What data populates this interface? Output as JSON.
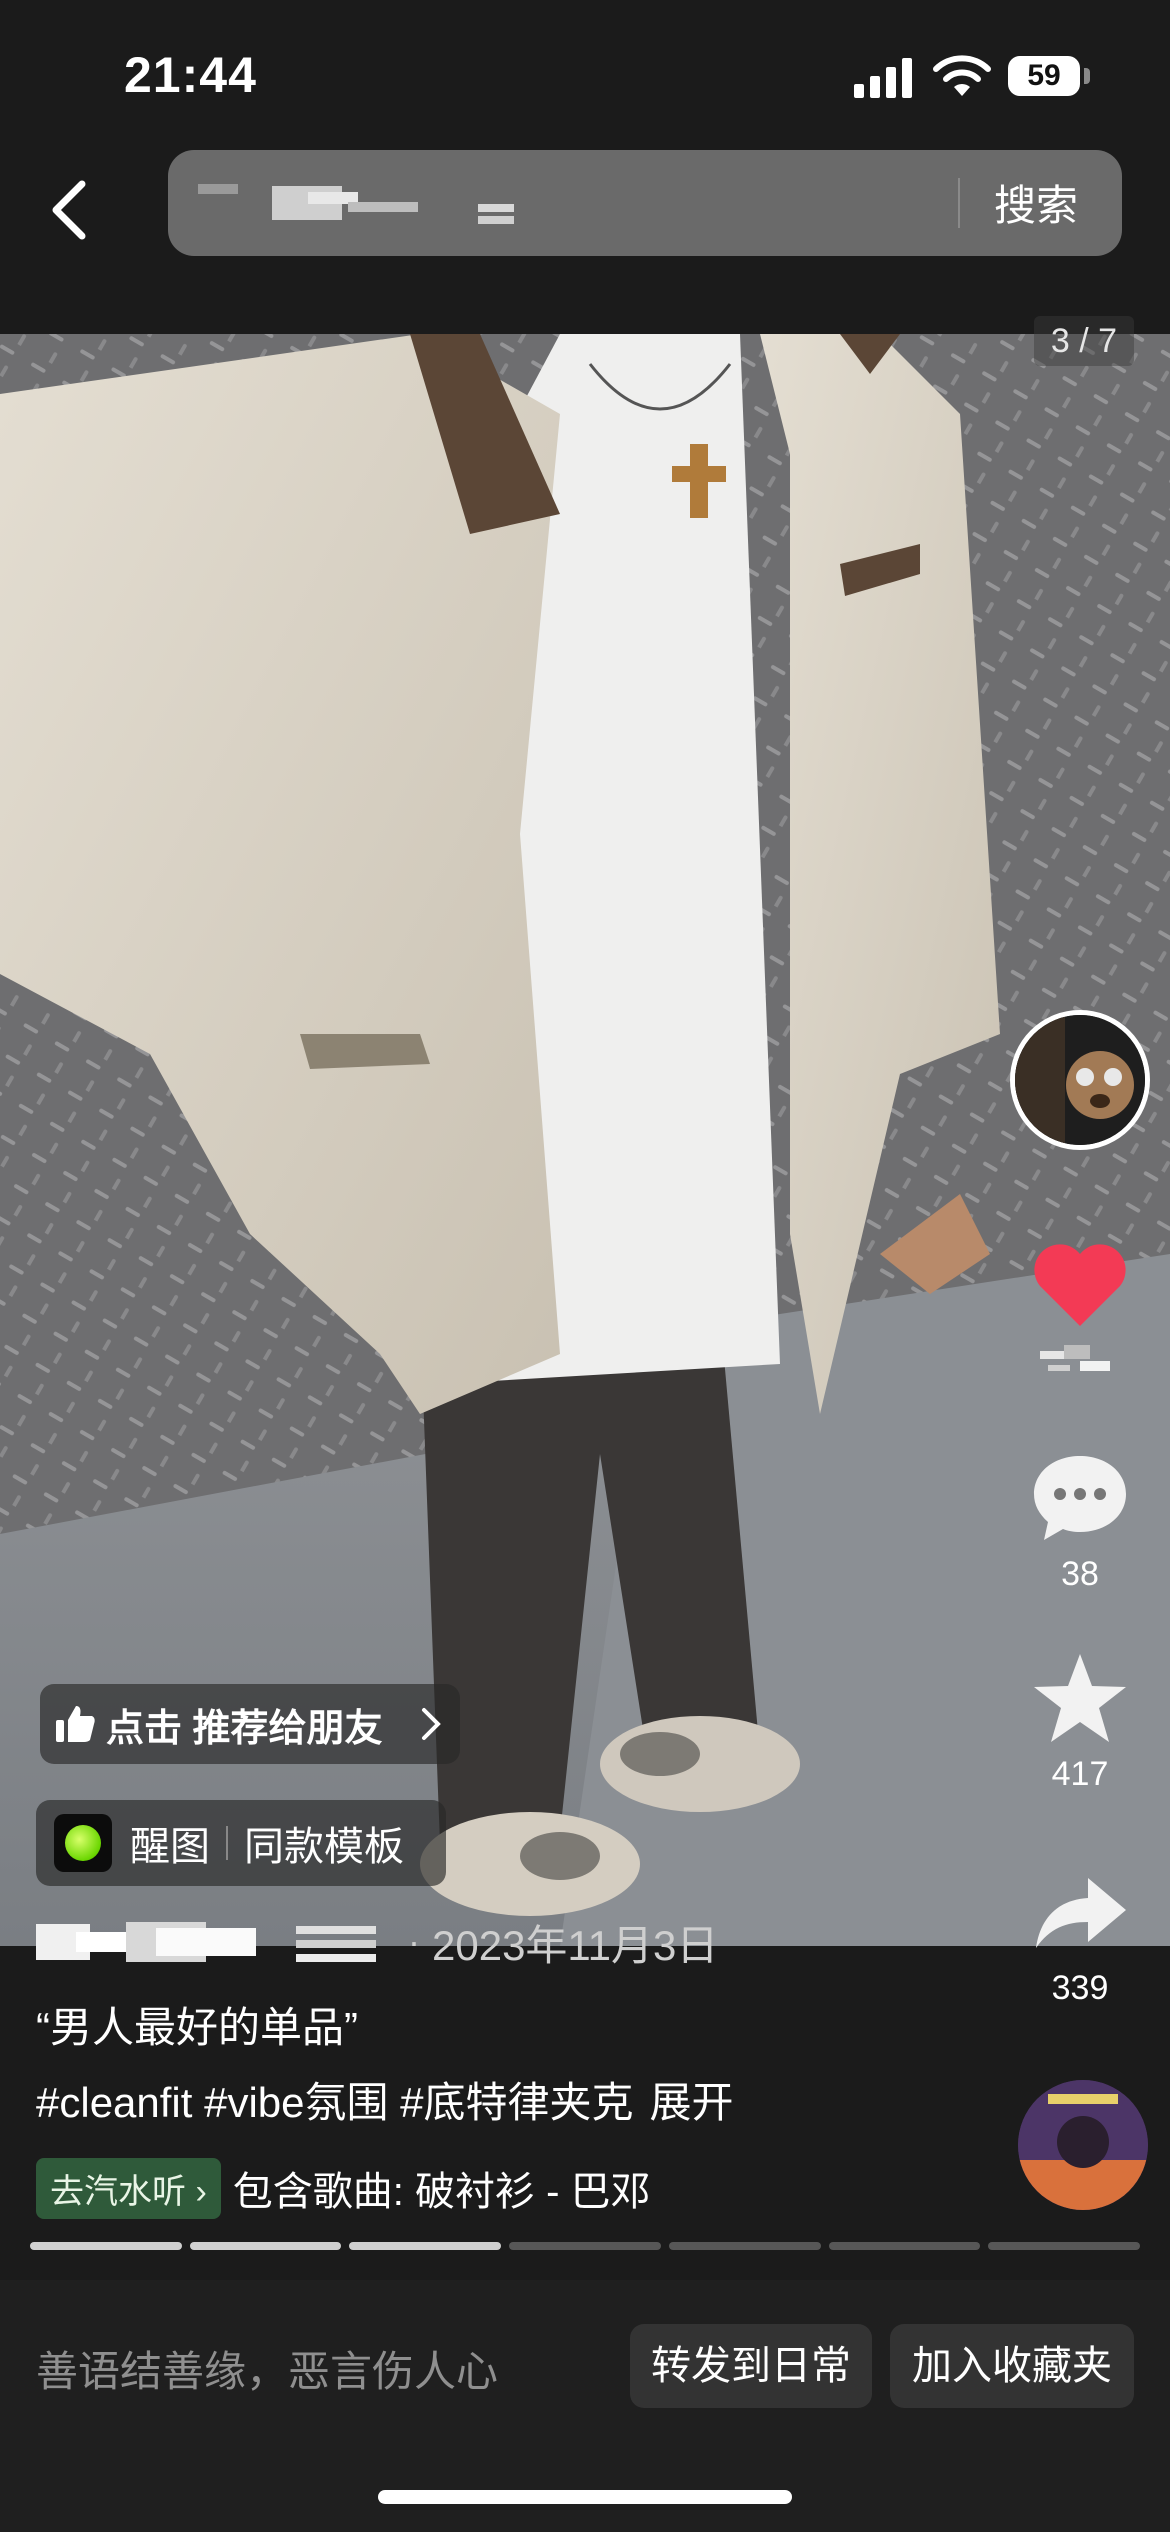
{
  "status": {
    "time": "21:44",
    "battery": "59"
  },
  "search": {
    "button_label": "搜索"
  },
  "post": {
    "page_indicator": "3 / 7",
    "recommend_label": "点击 推荐给朋友",
    "template_app": "醒图",
    "template_label": "同款模板",
    "date": "2023年11月3日",
    "title": "“男人最好的单品”",
    "tags": "#cleanfit #vibe氛围 #底特律夹克",
    "expand_label": "展开",
    "music_chip": "去汽水听 ›",
    "music_text": "包含歌曲: 破衬衫 - 巴邓",
    "progress": {
      "current": 3,
      "total": 7
    }
  },
  "actions": {
    "comments": "38",
    "favorites": "417",
    "shares": "339"
  },
  "bottom": {
    "comment_placeholder": "善语结善缘，恶言伤人心",
    "share_daily_label": "转发到日常",
    "add_collection_label": "加入收藏夹"
  },
  "colors": {
    "like_red": "#f33a55",
    "music_chip_bg": "#2f5a3a",
    "bottom_bar": "#1f1f1f"
  }
}
